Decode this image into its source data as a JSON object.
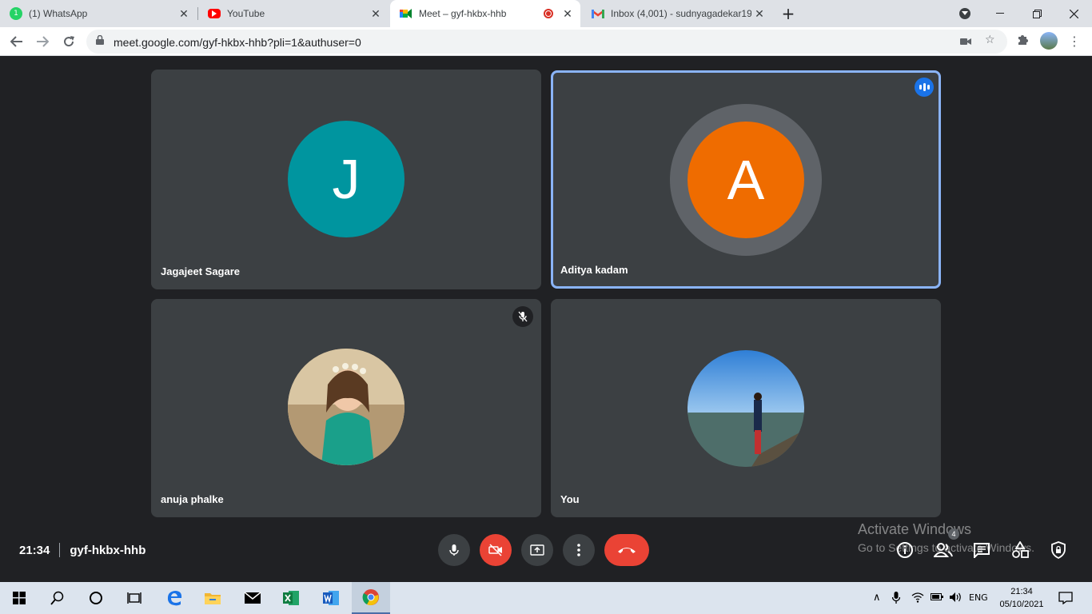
{
  "browser": {
    "tabs": [
      {
        "title": "(1) WhatsApp",
        "favicon": "whatsapp-icon",
        "badge": "1",
        "color": "#25d366"
      },
      {
        "title": "YouTube",
        "favicon": "youtube-icon",
        "color": "#ff0000"
      },
      {
        "title": "Meet – gyf-hkbx-hhb",
        "favicon": "meet-icon",
        "color": "#00832d",
        "active": true
      },
      {
        "title": "Inbox (4,001) - sudnyagadekar19",
        "favicon": "gmail-icon",
        "color": "#ea4335"
      }
    ],
    "close_glyph": "✕",
    "new_tab_glyph": "+",
    "url": "meet.google.com/gyf-hkbx-hhb?pli=1&authuser=0"
  },
  "meet": {
    "participants": [
      {
        "name": "Jagajeet Sagare",
        "initial": "J",
        "color": "#00959f",
        "type": "initial"
      },
      {
        "name": "Aditya kadam",
        "initial": "A",
        "color": "#ef6c00",
        "type": "initial",
        "speaking": true
      },
      {
        "name": "anuja phalke",
        "type": "photo",
        "muted": true
      },
      {
        "name": "You",
        "type": "photo"
      }
    ],
    "time": "21:34",
    "meeting_code": "gyf-hkbx-hhb",
    "participant_count": "4"
  },
  "watermark": {
    "line1": "Activate Windows",
    "line2": "Go to Settings to activate Windows."
  },
  "taskbar": {
    "lang": "ENG",
    "time": "21:34",
    "date": "05/10/2021"
  }
}
